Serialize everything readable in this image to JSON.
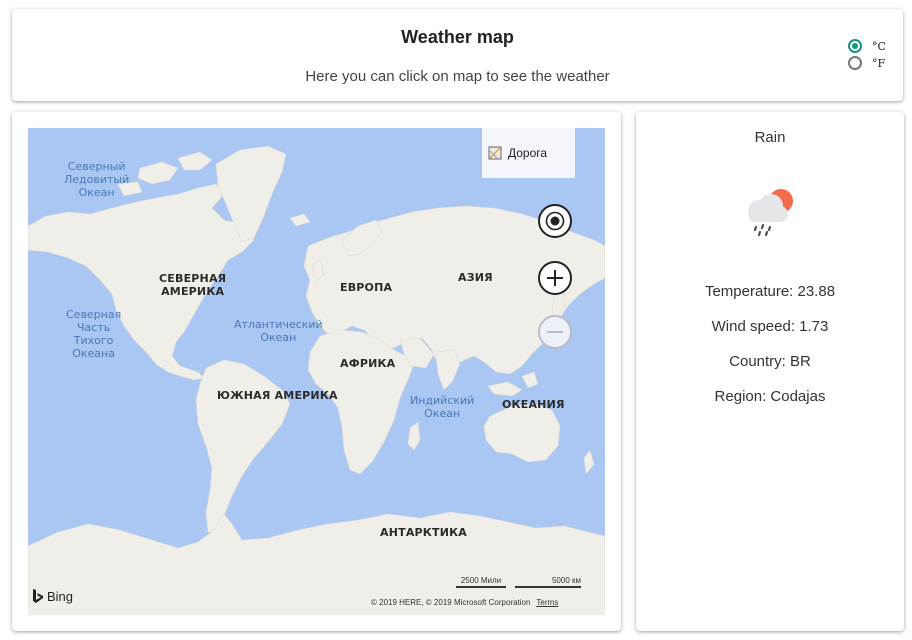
{
  "header": {
    "title": "Weather map",
    "subtitle": "Here you can click on map to see the weather",
    "units": [
      {
        "label": "°C",
        "selected": true
      },
      {
        "label": "°F",
        "selected": false
      }
    ]
  },
  "map": {
    "layer_button": "Дорога",
    "continents": [
      "СЕВЕРНАЯ\nАМЕРИКА",
      "ЕВРОПА",
      "АЗИЯ",
      "АФРИКА",
      "ЮЖНАЯ АМЕРИКА",
      "ОКЕАНИЯ",
      "АНТАРКТИКА"
    ],
    "oceans": [
      "Северный\nЛедовитый\nОкеан",
      "Северная\nЧасть\nТихого\nОкеана",
      "Атлантический\nОкеан",
      "Индийский\nОкеан"
    ],
    "scale_miles": "2500 Мили",
    "scale_km": "5000 км",
    "attribution": "© 2019 HERE, © 2019 Microsoft Corporation",
    "terms": "Terms",
    "logo": "Bing",
    "colors": {
      "water": "#a9c7f2",
      "land": "#efeee9"
    }
  },
  "weather": {
    "condition": "Rain",
    "icon": "rain-cloud-sun-icon",
    "temperature": "Temperature: 23.88",
    "wind_speed": "Wind speed: 1.73",
    "country": "Country: BR",
    "region": "Region: Codajas"
  },
  "colors": {
    "accent": "#15967e",
    "sun": "#f36b4c"
  }
}
